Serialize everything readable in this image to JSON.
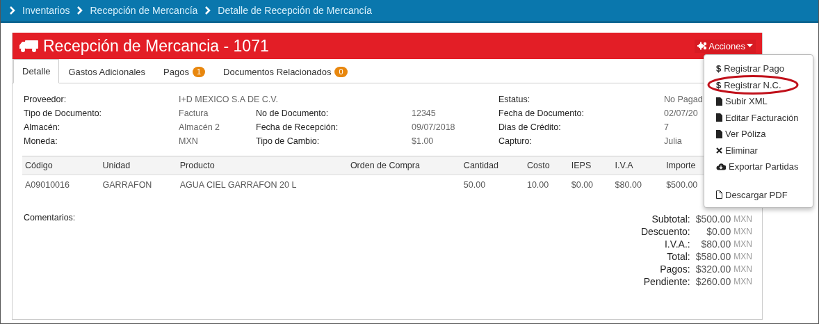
{
  "breadcrumb": [
    "Inventarios",
    "Recepción de Mercancía",
    "Detalle de Recepción de Mercancía"
  ],
  "header": {
    "title": "Recepción de Mercancia - 1071",
    "actions_button": "Acciones"
  },
  "tabs": [
    {
      "label": "Detalle",
      "selected": true
    },
    {
      "label": "Gastos Adicionales",
      "selected": false
    },
    {
      "label": "Pagos",
      "badge": "1",
      "selected": false
    },
    {
      "label": "Documentos Relacionados",
      "badge": "0",
      "selected": false
    }
  ],
  "details": [
    {
      "fields": [
        {
          "label": "Proveedor:",
          "value": "I+D MEXICO S.A DE C.V."
        },
        {
          "label": "Estatus:",
          "value": "No Pagad"
        }
      ]
    },
    {
      "fields": [
        {
          "label": "Tipo de Documento:",
          "value": "Factura"
        },
        {
          "label": "No de Documento:",
          "value": "12345"
        },
        {
          "label": "Fecha de Documento:",
          "value": "02/07/20"
        }
      ]
    },
    {
      "fields": [
        {
          "label": "Almacén:",
          "value": "Almacén 2"
        },
        {
          "label": "Fecha de Recepción:",
          "value": "09/07/2018"
        },
        {
          "label": "Dias de Crédito:",
          "value": "7"
        }
      ]
    },
    {
      "fields": [
        {
          "label": "Moneda:",
          "value": "MXN"
        },
        {
          "label": "Tipo de Cambio:",
          "value": "$1.00"
        },
        {
          "label": "Capturo:",
          "value": "Julia"
        }
      ]
    }
  ],
  "table": {
    "columns": [
      "Código",
      "Unidad",
      "Producto",
      "Orden de Compra",
      "Cantidad",
      "Costo",
      "IEPS",
      "I.V.A",
      "Importe"
    ],
    "rows": [
      [
        "A09010016",
        "GARRAFON",
        "AGUA CIEL GARRAFON 20 L",
        "",
        "50.00",
        "10.00",
        "$0.00",
        "$80.00",
        "$500.00"
      ]
    ]
  },
  "comments_label": "Comentarios:",
  "totals": [
    {
      "label": "Subtotal:",
      "amount": "$500.00",
      "currency": "MXN"
    },
    {
      "label": "Descuento:",
      "amount": "$0.00",
      "currency": "MXN"
    },
    {
      "label": "I.V.A.:",
      "amount": "$80.00",
      "currency": "MXN"
    },
    {
      "label": "Total:",
      "amount": "$580.00",
      "currency": "MXN"
    },
    {
      "label": "Pagos:",
      "amount": "$320.00",
      "currency": "MXN"
    },
    {
      "label": "Pendiente:",
      "amount": "$260.00",
      "currency": "MXN"
    }
  ],
  "actions_menu": [
    {
      "kind": "dollar",
      "symbol": "$",
      "label": "Registrar Pago",
      "highlighted": false
    },
    {
      "kind": "dollar",
      "symbol": "$",
      "label": "Registrar N.C.",
      "highlighted": true
    },
    {
      "kind": "file",
      "label": "Subir XML",
      "highlighted": false
    },
    {
      "kind": "file",
      "label": "Editar Facturación",
      "highlighted": false
    },
    {
      "kind": "file",
      "label": "Ver Póliza",
      "highlighted": false
    },
    {
      "kind": "remove",
      "label": "Eliminar",
      "highlighted": false
    },
    {
      "kind": "cloud",
      "label": "Exportar Partidas",
      "highlighted": false
    },
    {
      "kind": "file-outline",
      "label": "Descargar PDF",
      "highlighted": false
    }
  ]
}
